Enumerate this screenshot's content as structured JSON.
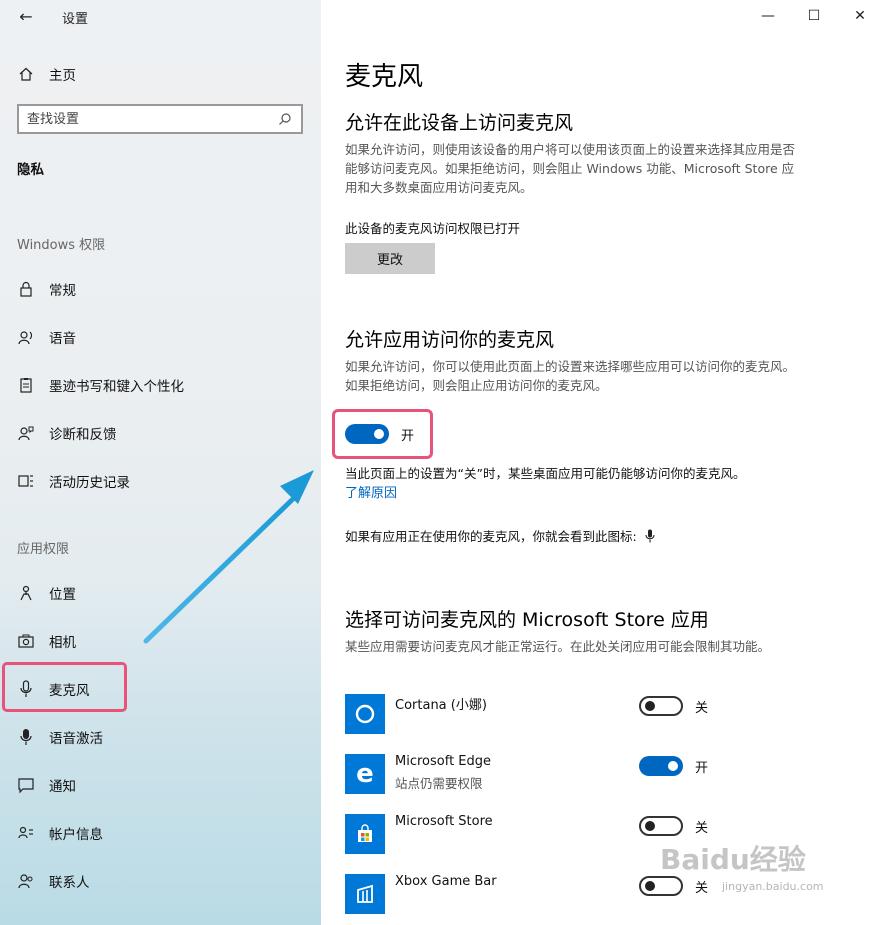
{
  "window": {
    "title": "设置",
    "controls": {
      "minimize": "—",
      "maximize": "☐",
      "close": "✕"
    }
  },
  "sidebar": {
    "home_label": "主页",
    "search_placeholder": "查找设置",
    "section_title": "隐私",
    "windows_group": "Windows 权限",
    "app_group": "应用权限",
    "windows_items": [
      {
        "label": "常规",
        "icon": "lock-icon"
      },
      {
        "label": "语音",
        "icon": "speech-icon"
      },
      {
        "label": "墨迹书写和键入个性化",
        "icon": "clipboard-icon"
      },
      {
        "label": "诊断和反馈",
        "icon": "feedback-icon"
      },
      {
        "label": "活动历史记录",
        "icon": "timeline-icon"
      }
    ],
    "app_items": [
      {
        "label": "位置",
        "icon": "location-icon"
      },
      {
        "label": "相机",
        "icon": "camera-icon"
      },
      {
        "label": "麦克风",
        "icon": "microphone-icon",
        "selected": true
      },
      {
        "label": "语音激活",
        "icon": "voice-activation-icon"
      },
      {
        "label": "通知",
        "icon": "notification-icon"
      },
      {
        "label": "帐户信息",
        "icon": "account-info-icon"
      },
      {
        "label": "联系人",
        "icon": "contacts-icon"
      }
    ]
  },
  "main": {
    "page_title": "麦克风",
    "device_section": {
      "heading": "允许在此设备上访问麦克风",
      "desc": "如果允许访问，则使用该设备的用户将可以使用该页面上的设置来选择其应用是否能够访问麦克风。如果拒绝访问，则会阻止 Windows 功能、Microsoft Store 应用和大多数桌面应用访问麦克风。",
      "status": "此设备的麦克风访问权限已打开",
      "change_button": "更改"
    },
    "apps_section": {
      "heading": "允许应用访问你的麦克风",
      "desc": "如果允许访问，你可以使用此页面上的设置来选择哪些应用可以访问你的麦克风。如果拒绝访问，则会阻止应用访问你的麦克风。",
      "toggle_state": "开",
      "toggle_on": true,
      "note": "当此页面上的设置为“关”时，某些桌面应用可能仍能够访问你的麦克风。",
      "learn_more": "了解原因",
      "icon_note": "如果有应用正在使用你的麦克风，你就会看到此图标:"
    },
    "store_section": {
      "heading": "选择可访问麦克风的 Microsoft Store 应用",
      "desc": "某些应用需要访问麦克风才能正常运行。在此处关闭应用可能会限制其功能。",
      "apps": [
        {
          "name": "Cortana (小娜)",
          "subtitle": "",
          "state": "关",
          "on": false,
          "icon": "cortana-icon"
        },
        {
          "name": "Microsoft Edge",
          "subtitle": "站点仍需要权限",
          "state": "开",
          "on": true,
          "icon": "edge-icon"
        },
        {
          "name": "Microsoft Store",
          "subtitle": "",
          "state": "关",
          "on": false,
          "icon": "store-icon"
        },
        {
          "name": "Xbox Game Bar",
          "subtitle": "",
          "state": "关",
          "on": false,
          "icon": "xbox-game-bar-icon"
        }
      ]
    }
  },
  "colors": {
    "accent": "#0067c0",
    "highlight": "#e8537a",
    "arrow": "#29a8e0",
    "tile": "#0078d7"
  },
  "watermark": {
    "text": "Baidu经验",
    "sub": "jingyan.baidu.com"
  }
}
